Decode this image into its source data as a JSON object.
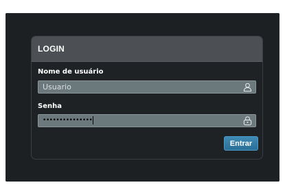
{
  "login": {
    "title": "LOGIN",
    "username": {
      "label": "Nome de usuário",
      "placeholder": "Usuario",
      "value": "",
      "icon": "user-icon"
    },
    "password": {
      "label": "Senha",
      "value_masked": "•••••••••••••••",
      "icon": "lock-icon"
    },
    "submit_label": "Entrar"
  },
  "colors": {
    "background": "#1d2023",
    "panel_header": "#4c5055",
    "input": "#6b787c",
    "button": "#2f7aa6"
  }
}
